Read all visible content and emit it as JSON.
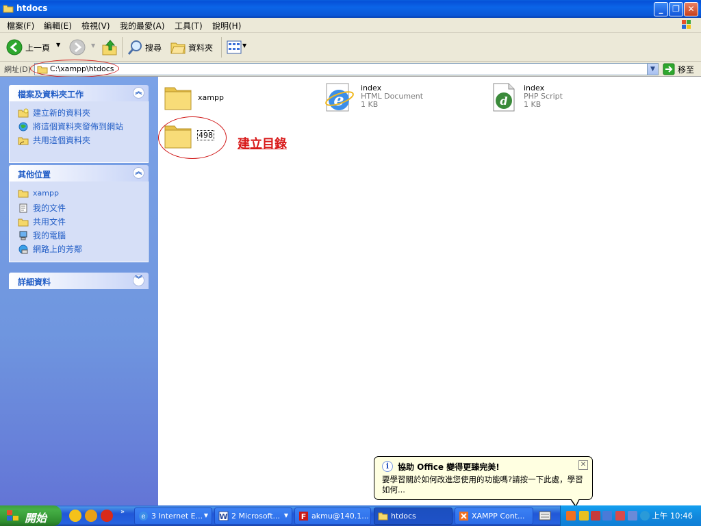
{
  "window": {
    "title": "htdocs"
  },
  "menu": [
    "檔案(F)",
    "編輯(E)",
    "檢視(V)",
    "我的最愛(A)",
    "工具(T)",
    "說明(H)"
  ],
  "toolbar": {
    "back_label": "上一頁",
    "search_label": "搜尋",
    "folders_label": "資料夾"
  },
  "address": {
    "label": "網址(D)",
    "value": "C:\\xampp\\htdocs",
    "go_label": "移至"
  },
  "tasks_panel": {
    "title": "檔案及資料夾工作",
    "items": [
      "建立新的資料夾",
      "將這個資料夾發佈到網站",
      "共用這個資料夾"
    ]
  },
  "places_panel": {
    "title": "其他位置",
    "items": [
      "xampp",
      "我的文件",
      "共用文件",
      "我的電腦",
      "網路上的芳鄰"
    ]
  },
  "details_panel": {
    "title": "詳細資料"
  },
  "files": [
    {
      "name": "xampp",
      "type": "",
      "size": ""
    },
    {
      "name": "index",
      "type": "HTML Document",
      "size": "1 KB"
    },
    {
      "name": "index",
      "type": "PHP Script",
      "size": "1 KB"
    },
    {
      "name": "498",
      "type": "",
      "size": ""
    }
  ],
  "annotation": {
    "text": "建立目錄"
  },
  "balloon": {
    "title": "協助 Office 變得更臻完美!",
    "body": "要學習關於如何改進您使用的功能嗎?請按一下此處，學習如何..."
  },
  "taskbar": {
    "start_label": "開始",
    "buttons": [
      "3 Internet E...",
      "2 Microsoft...",
      "akmu@140.1...",
      "htdocs",
      "XAMPP Cont..."
    ],
    "clock": "上午 10:46"
  },
  "colors": {
    "titlebar": "#0a5fde",
    "link": "#215dc6",
    "annotation": "#d81818"
  }
}
